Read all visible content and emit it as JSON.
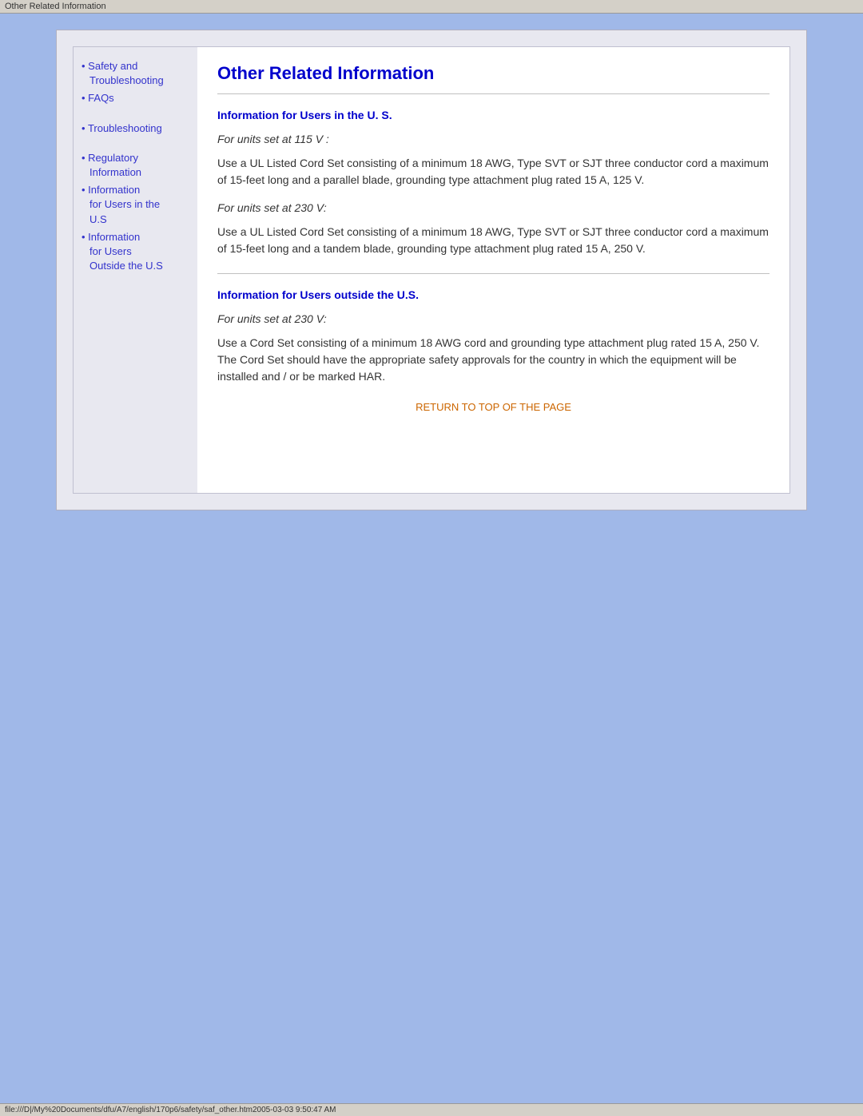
{
  "browser": {
    "title": "Other Related Information",
    "status_bar": "file:///D|/My%20Documents/dfu/A7/english/170p6/safety/saf_other.htm2005-03-03 9:50:47 AM"
  },
  "sidebar": {
    "nav_items": [
      {
        "id": "safety",
        "label_line1": "Safety and",
        "label_line2": "Troubleshooting",
        "bullet": "•"
      },
      {
        "id": "faqs",
        "label": "FAQs",
        "bullet": "•"
      },
      {
        "id": "troubleshooting",
        "label": "Troubleshooting",
        "bullet": "•"
      },
      {
        "id": "regulatory",
        "label_line1": "Regulatory",
        "label_line2": "Information",
        "bullet": "•"
      },
      {
        "id": "info-us",
        "label_line1": "Information",
        "label_line2": "for Users in the",
        "label_line3": "U.S",
        "bullet": "•"
      },
      {
        "id": "info-outside",
        "label_line1": "Information",
        "label_line2": "for Users",
        "label_line3": "Outside the U.S",
        "bullet": "•"
      }
    ]
  },
  "main": {
    "page_title": "Other Related Information",
    "section_us": {
      "title": "Information for Users in the U. S.",
      "subsection_115": {
        "italic": "For units set at 115 V :",
        "body": "Use a UL Listed Cord Set consisting of a minimum 18 AWG, Type SVT or SJT three conductor cord a maximum of 15-feet long and a parallel blade, grounding type attachment plug rated 15 A, 125 V."
      },
      "subsection_230": {
        "italic": "For units set at 230 V:",
        "body": "Use a UL Listed Cord Set consisting of a minimum 18 AWG, Type SVT or SJT three conductor cord a maximum of 15-feet long and a tandem blade, grounding type attachment plug rated 15 A, 250 V."
      }
    },
    "section_outside": {
      "title": "Information for Users outside the U.S.",
      "subsection_230": {
        "italic": "For units set at 230 V:",
        "body": "Use a Cord Set consisting of a minimum 18 AWG cord and grounding type attachment plug rated 15 A, 250 V. The Cord Set should have the appropriate safety approvals for the country in which the equipment will be installed and / or be marked HAR."
      }
    },
    "return_link": "RETURN TO TOP OF THE PAGE"
  }
}
